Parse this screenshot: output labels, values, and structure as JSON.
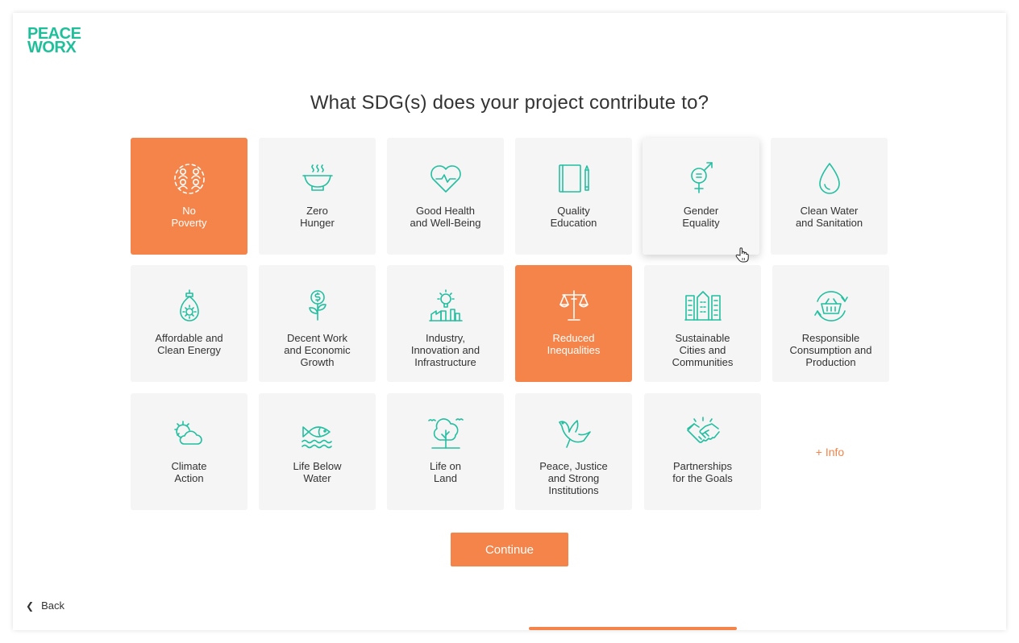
{
  "logo": {
    "line1": "PEACE",
    "line2": "WORX"
  },
  "title": "What SDG(s) does your project contribute to?",
  "sdgs": [
    {
      "label": "No\nPoverty",
      "icon": "people-circle-icon",
      "selected": true
    },
    {
      "label": "Zero\nHunger",
      "icon": "bowl-icon",
      "selected": false
    },
    {
      "label": "Good Health\nand Well-Being",
      "icon": "heartbeat-icon",
      "selected": false
    },
    {
      "label": "Quality\nEducation",
      "icon": "book-pencil-icon",
      "selected": false
    },
    {
      "label": "Gender\nEquality",
      "icon": "gender-equality-icon",
      "selected": false
    },
    {
      "label": "Clean Water\nand Sanitation",
      "icon": "water-drop-icon",
      "selected": false
    },
    {
      "label": "Affordable and\nClean Energy",
      "icon": "lightbulb-sun-icon",
      "selected": false
    },
    {
      "label": "Decent Work\nand Economic\nGrowth",
      "icon": "money-plant-icon",
      "selected": false
    },
    {
      "label": "Industry,\nInnovation and\nInfrastructure",
      "icon": "idea-factory-icon",
      "selected": false
    },
    {
      "label": "Reduced\nInequalities",
      "icon": "scales-icon",
      "selected": true
    },
    {
      "label": "Sustainable\nCities and\nCommunities",
      "icon": "city-buildings-icon",
      "selected": false
    },
    {
      "label": "Responsible\nConsumption and\nProduction",
      "icon": "basket-cycle-icon",
      "selected": false
    },
    {
      "label": "Climate\nAction",
      "icon": "sun-cloud-icon",
      "selected": false
    },
    {
      "label": "Life Below\nWater",
      "icon": "fish-waves-icon",
      "selected": false
    },
    {
      "label": "Life on\nLand",
      "icon": "tree-birds-icon",
      "selected": false
    },
    {
      "label": "Peace, Justice\nand Strong\nInstitutions",
      "icon": "dove-icon",
      "selected": false
    },
    {
      "label": "Partnerships\nfor the Goals",
      "icon": "handshake-icon",
      "selected": false
    }
  ],
  "info_link": "+ Info",
  "continue_label": "Continue",
  "back_label": "Back",
  "colors": {
    "accent": "#f4844a",
    "brand": "#1fbf9a",
    "icon": "#23bfa0",
    "tile": "#f5f5f5"
  }
}
